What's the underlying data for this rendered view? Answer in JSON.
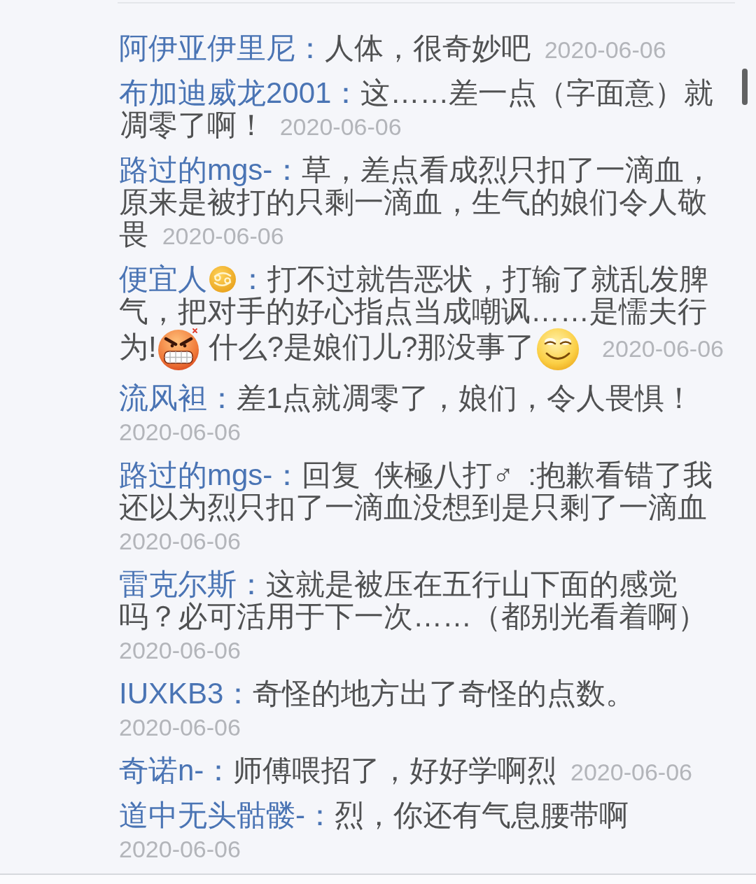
{
  "comments": [
    {
      "author": [
        {
          "kind": "text",
          "text": "阿伊亚伊里尼："
        }
      ],
      "content": [
        {
          "kind": "text",
          "text": "人体，很奇妙吧"
        }
      ],
      "date": "2020-06-06"
    },
    {
      "author": [
        {
          "kind": "text",
          "text": "布加迪威龙2001："
        }
      ],
      "content": [
        {
          "kind": "text",
          "text": "这……差一点（字面意）就凋零了啊！"
        }
      ],
      "date": "2020-06-06"
    },
    {
      "author": [
        {
          "kind": "text",
          "text": "路过的mgs-："
        }
      ],
      "content": [
        {
          "kind": "text",
          "text": "草，差点看成烈只扣了一滴血，原来是被打的只剩一滴血，生气的娘们令人敬畏"
        }
      ],
      "date": "2020-06-06"
    },
    {
      "author": [
        {
          "kind": "text",
          "text": "便宜人"
        },
        {
          "kind": "zodiac"
        },
        {
          "kind": "text",
          "text": "："
        }
      ],
      "content": [
        {
          "kind": "text",
          "text": "打不过就告恶状，打输了就乱发脾气，把对手的好心指点当成嘲讽……是懦夫行为!"
        },
        {
          "kind": "angry"
        },
        {
          "kind": "text",
          "text": "什么?是娘们儿?那没事了"
        },
        {
          "kind": "grin"
        }
      ],
      "date": "2020-06-06"
    },
    {
      "author": [
        {
          "kind": "text",
          "text": "流风袒："
        }
      ],
      "content": [
        {
          "kind": "text",
          "text": "差1点就凋零了，娘们，令人畏惧！"
        }
      ],
      "date": "2020-06-06"
    },
    {
      "author": [
        {
          "kind": "text",
          "text": "路过的mgs-："
        }
      ],
      "content": [
        {
          "kind": "text",
          "text": "回复 侠極八打♂ :抱歉看错了我还以为烈只扣了一滴血没想到是只剩了一滴血"
        }
      ],
      "date": "2020-06-06"
    },
    {
      "author": [
        {
          "kind": "text",
          "text": "雷克尔斯："
        }
      ],
      "content": [
        {
          "kind": "text",
          "text": "这就是被压在五行山下面的感觉吗？必可活用于下一次……（都别光看着啊）"
        }
      ],
      "date": "2020-06-06"
    },
    {
      "author": [
        {
          "kind": "text",
          "text": "IUXKB3："
        }
      ],
      "content": [
        {
          "kind": "text",
          "text": "奇怪的地方出了奇怪的点数。"
        }
      ],
      "date": "2020-06-06"
    },
    {
      "author": [
        {
          "kind": "text",
          "text": "奇诺n-："
        }
      ],
      "content": [
        {
          "kind": "text",
          "text": "师傅喂招了，好好学啊烈"
        }
      ],
      "date": "2020-06-06"
    },
    {
      "author": [
        {
          "kind": "text",
          "text": "道中无头骷髅-："
        }
      ],
      "content": [
        {
          "kind": "text",
          "text": "烈，你还有气息腰带啊"
        }
      ],
      "date": "2020-06-06"
    }
  ]
}
